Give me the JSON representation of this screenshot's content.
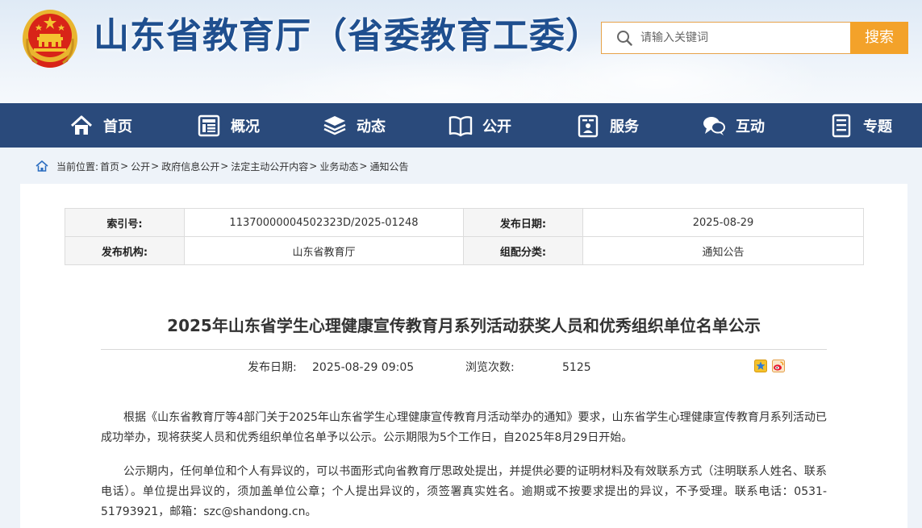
{
  "header": {
    "site_title": "山东省教育厅（省委教育工委）",
    "search_placeholder": "请输入关键词",
    "search_button": "搜索"
  },
  "nav": {
    "items": [
      {
        "label": "首页",
        "icon": "home-icon"
      },
      {
        "label": "概况",
        "icon": "overview-icon"
      },
      {
        "label": "动态",
        "icon": "news-stack-icon"
      },
      {
        "label": "公开",
        "icon": "open-book-icon"
      },
      {
        "label": "服务",
        "icon": "service-icon"
      },
      {
        "label": "互动",
        "icon": "chat-icon"
      },
      {
        "label": "专题",
        "icon": "topic-icon"
      }
    ]
  },
  "breadcrumb": {
    "prefix": "当前位置:",
    "items": [
      "首页",
      "公开",
      "政府信息公开",
      "法定主动公开内容",
      "业务动态",
      "通知公告"
    ],
    "separator": ">"
  },
  "meta": {
    "index_label": "索引号:",
    "index_value": "11370000004502323D/2025-01248",
    "date_label": "发布日期:",
    "date_value": "2025-08-29",
    "org_label": "发布机构:",
    "org_value": "山东省教育厅",
    "category_label": "组配分类:",
    "category_value": "通知公告"
  },
  "article": {
    "title": "2025年山东省学生心理健康宣传教育月系列活动获奖人员和优秀组织单位名单公示",
    "publish_label": "发布日期:",
    "publish_value": "2025-08-29 09:05",
    "views_label": "浏览次数:",
    "views_value": "5125",
    "paragraphs": [
      "根据《山东省教育厅等4部门关于2025年山东省学生心理健康宣传教育月活动举办的通知》要求，山东省学生心理健康宣传教育月系列活动已成功举办，现将获奖人员和优秀组织单位名单予以公示。公示期限为5个工作日，自2025年8月29日开始。",
      "公示期内，任何单位和个人有异议的，可以书面形式向省教育厅思政处提出，并提供必要的证明材料及有效联系方式（注明联系人姓名、联系电话）。单位提出异议的，须加盖单位公章；个人提出异议的，须签署真实姓名。逾期或不按要求提出的异议，不予受理。联系电话：0531-51793921，邮箱：szc@shandong.cn。"
    ]
  },
  "colors": {
    "nav_bg": "#2a4a7b",
    "title_blue": "#1f4f8f",
    "search_orange": "#f3a22a"
  }
}
